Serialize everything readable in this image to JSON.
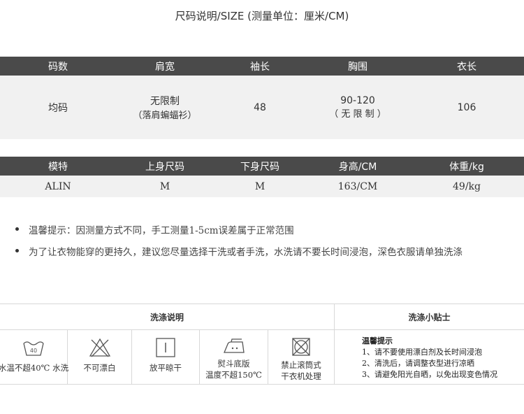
{
  "title": "尺码说明/SIZE (测量单位：厘米/CM)",
  "size_table": {
    "headers": [
      "码数",
      "肩宽",
      "袖长",
      "胸围",
      "衣长"
    ],
    "row": {
      "size": "均码",
      "shoulder_line1": "无限制",
      "shoulder_line2": "（落肩蝙蝠衫）",
      "sleeve": "48",
      "chest_line1": "90-120",
      "chest_line2": "（ 无 限 制 ）",
      "length": "106"
    }
  },
  "model_table": {
    "headers": [
      "模特",
      "上身尺码",
      "下身尺码",
      "身高/CM",
      "体重/kg"
    ],
    "row": [
      "ALIN",
      "M",
      "M",
      "163/CM",
      "49/kg"
    ]
  },
  "notes": [
    "温馨提示：因测量方式不同，手工测量1-5cm误差属于正常范围",
    "为了让衣物能穿的更持久，建议您尽量选择干洗或者手洗，水洗请不要长时间浸泡，深色衣服请单独洗涤"
  ],
  "care": {
    "wash_header": "洗涤说明",
    "tips_header": "洗涤小贴士",
    "icons": [
      {
        "icon": "wash-tub-icon",
        "line1": "水温不超40℃ 水洗",
        "line2": ""
      },
      {
        "icon": "no-bleach-icon",
        "line1": "不可漂白",
        "line2": ""
      },
      {
        "icon": "dry-flat-icon",
        "line1": "放平晾干",
        "line2": ""
      },
      {
        "icon": "iron-icon",
        "line1": "熨斗底版",
        "line2": "温度不超150℃"
      },
      {
        "icon": "no-tumble-dry-icon",
        "line1": "禁止滚筒式",
        "line2": "干衣机处理"
      }
    ],
    "tips": {
      "heading": "温馨提示",
      "items": [
        "1、请不要使用漂白剂及长时间浸泡",
        "2、清洗后，请调整衣型进行凉晒",
        "3、请避免阳光自晒，以免出现变色情况"
      ]
    }
  }
}
